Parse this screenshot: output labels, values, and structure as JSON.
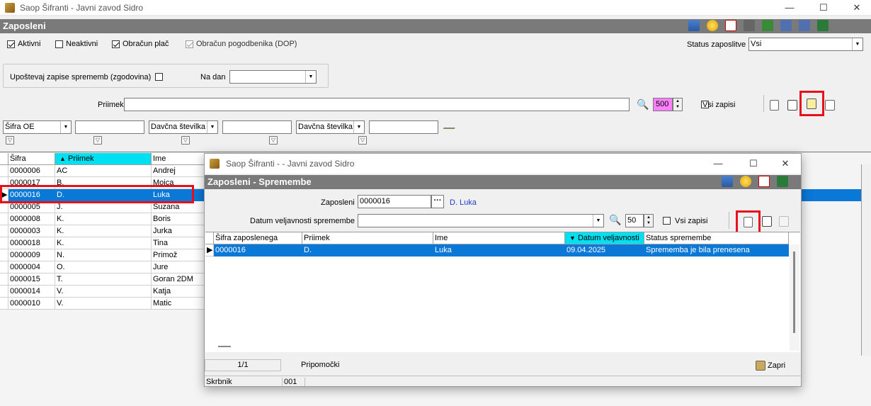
{
  "window": {
    "title": "Saop Šifranti - Javni zavod Sidro",
    "minimize": "—",
    "maximize": "☐",
    "close": "✕"
  },
  "section": {
    "title": "Zaposleni"
  },
  "filters": {
    "aktivni": {
      "label": "Aktivni",
      "checked": true
    },
    "neaktivni": {
      "label": "Neaktivni",
      "checked": false
    },
    "obracun_plac": {
      "label": "Obračun plač",
      "checked": true
    },
    "obracun_pogodbenika": {
      "label": "Obračun pogodbenika (DOP)",
      "checked": true
    },
    "status_label": "Status zaposlitve",
    "status_value": "Vsi",
    "upostevaj_label": "Upoštevaj zapise sprememb (zgodovina)",
    "na_dan_label": "Na dan",
    "na_dan_value": ""
  },
  "search": {
    "label": "Priimek",
    "value": "",
    "count": "500",
    "vsi_zapisi": "Vsi zapisi"
  },
  "column_filters": {
    "f1": "Šifra OE",
    "f2": "",
    "f3": "Davčna številka",
    "f4": "",
    "f5": "Davčna številka",
    "f6": ""
  },
  "grid": {
    "headers": [
      "Šifra",
      "Priimek",
      "Ime"
    ],
    "sort_arrow": "▲",
    "rows": [
      {
        "sifra": "0000006",
        "priimek": "AC",
        "ime": "Andrej"
      },
      {
        "sifra": "0000017",
        "priimek": "B.",
        "ime": "Mojca"
      },
      {
        "sifra": "0000016",
        "priimek": "D.",
        "ime": "Luka"
      },
      {
        "sifra": "0000005",
        "priimek": "J.",
        "ime": "Suzana"
      },
      {
        "sifra": "0000008",
        "priimek": "K.",
        "ime": "Boris"
      },
      {
        "sifra": "0000003",
        "priimek": "K.",
        "ime": "Jurka"
      },
      {
        "sifra": "0000018",
        "priimek": "K.",
        "ime": "Tina"
      },
      {
        "sifra": "0000009",
        "priimek": "N.",
        "ime": "Primož"
      },
      {
        "sifra": "0000004",
        "priimek": "O.",
        "ime": "Jure"
      },
      {
        "sifra": "0000015",
        "priimek": "T.",
        "ime": "Goran 2DM"
      },
      {
        "sifra": "0000014",
        "priimek": "V.",
        "ime": "Katja"
      },
      {
        "sifra": "0000010",
        "priimek": "V.",
        "ime": "Matic"
      }
    ],
    "selected_index": 2
  },
  "dialog": {
    "title": "Saop Šifranti -  - Javni zavod Sidro",
    "section": "Zaposleni - Spremembe",
    "zaposleni_label": "Zaposleni",
    "zaposleni_value": "0000016",
    "zaposleni_name": "D. Luka",
    "datum_label": "Datum veljavnosti spremembe",
    "datum_value": "",
    "count": "50",
    "vsi_zapisi": "Vsi zapisi",
    "headers": [
      "Šifra zaposlenega",
      "Priimek",
      "Ime",
      "Datum veljavnosti",
      "Status spremembe"
    ],
    "sort_arrow": "▼",
    "rows": [
      {
        "sifra": "0000016",
        "priimek": "D.",
        "ime": "Luka",
        "datum": "09.04.2025",
        "status": "Sprememba je bila prenesena"
      }
    ],
    "page": "1/1",
    "pripomocki": "Pripomočki",
    "zapri": "Zapri",
    "status_user": "Skrbnik",
    "status_code": "001"
  },
  "colors": {
    "selection": "#0a78d7",
    "section_bar": "#7a7a7a",
    "highlight": "#e8101a",
    "count_bg": "#ff80ff",
    "sort_header": "#00e0f0"
  }
}
